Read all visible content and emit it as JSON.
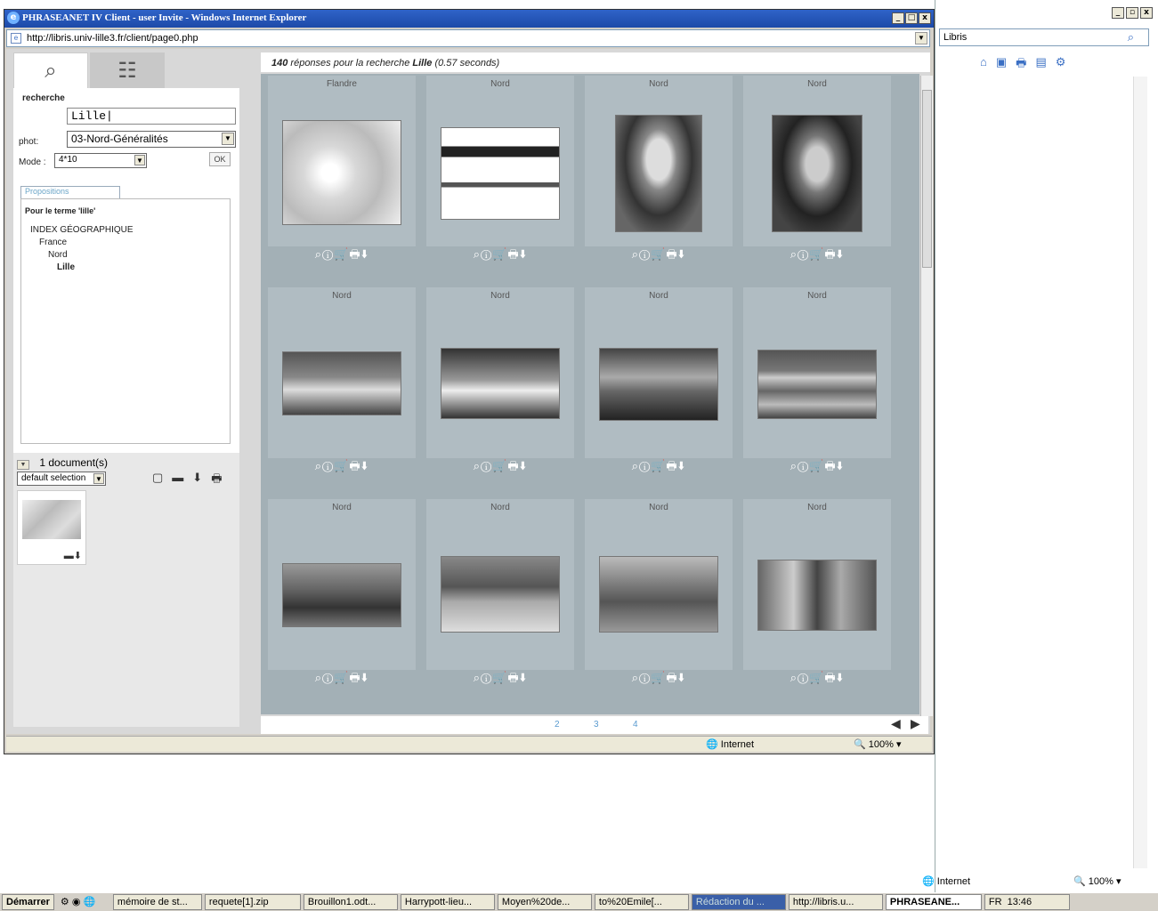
{
  "window": {
    "title": "PHRASEANET IV Client - user Invite - Windows Internet Explorer",
    "address": "http://libris.univ-lille3.fr/client/page0.php"
  },
  "bgwindow": {
    "search_value": "Libris"
  },
  "left": {
    "search_label": "recherche",
    "query": "Lille",
    "phot_label": "phot:",
    "phot_value": "03-Nord-Généralités",
    "mode_label": "Mode :",
    "mode_value": "4*10",
    "ok_label": "OK",
    "propositions_tab": "Propositions",
    "term_header": "Pour le terme 'lille'",
    "tree": [
      "INDEX GÉOGRAPHIQUE",
      "France",
      "Nord",
      "Lille"
    ],
    "basket_count": "1 document(s)",
    "basket_select": "default selection"
  },
  "results": {
    "header_count": "140",
    "header_text": " réponses pour la recherche ",
    "header_term": "Lille",
    "header_time": "  (0.57 seconds)",
    "captions": [
      "Flandre",
      "Nord",
      "Nord",
      "Nord",
      "Nord",
      "Nord",
      "Nord",
      "Nord",
      "Nord",
      "Nord",
      "Nord",
      "Nord"
    ],
    "tools": "⌕ⓘ🛒🖶⬇",
    "pages": [
      "2",
      "3",
      "4"
    ]
  },
  "status": {
    "zone": "Internet",
    "zoom": "100%"
  },
  "taskbar": {
    "start": "Démarrer",
    "items": [
      "mémoire de st...",
      "requete[1].zip",
      "Brouillon1.odt...",
      "Harrypott-lieu...",
      "Moyen%20de...",
      "to%20Emile[...",
      "Rédaction du ...",
      "http://libris.u...",
      "PHRASEANE..."
    ],
    "tray_lang": "FR",
    "clock": "13:46"
  }
}
